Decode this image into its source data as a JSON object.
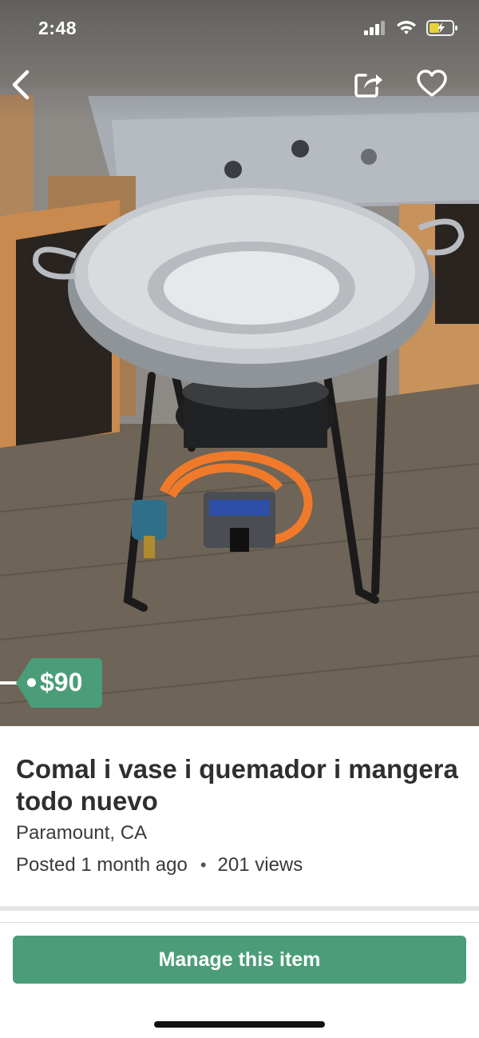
{
  "status_bar": {
    "time": "2:48"
  },
  "listing": {
    "price": "$90",
    "title": "Comal i vase i quemador i mangera todo nuevo",
    "location": "Paramount, CA",
    "posted": "Posted 1 month ago",
    "separator": "•",
    "views": "201 views",
    "photo_icon": "product-photo"
  },
  "actions": {
    "manage_label": "Manage this item"
  },
  "colors": {
    "accent": "#4a9d78",
    "divider": "#e6e6e6"
  }
}
